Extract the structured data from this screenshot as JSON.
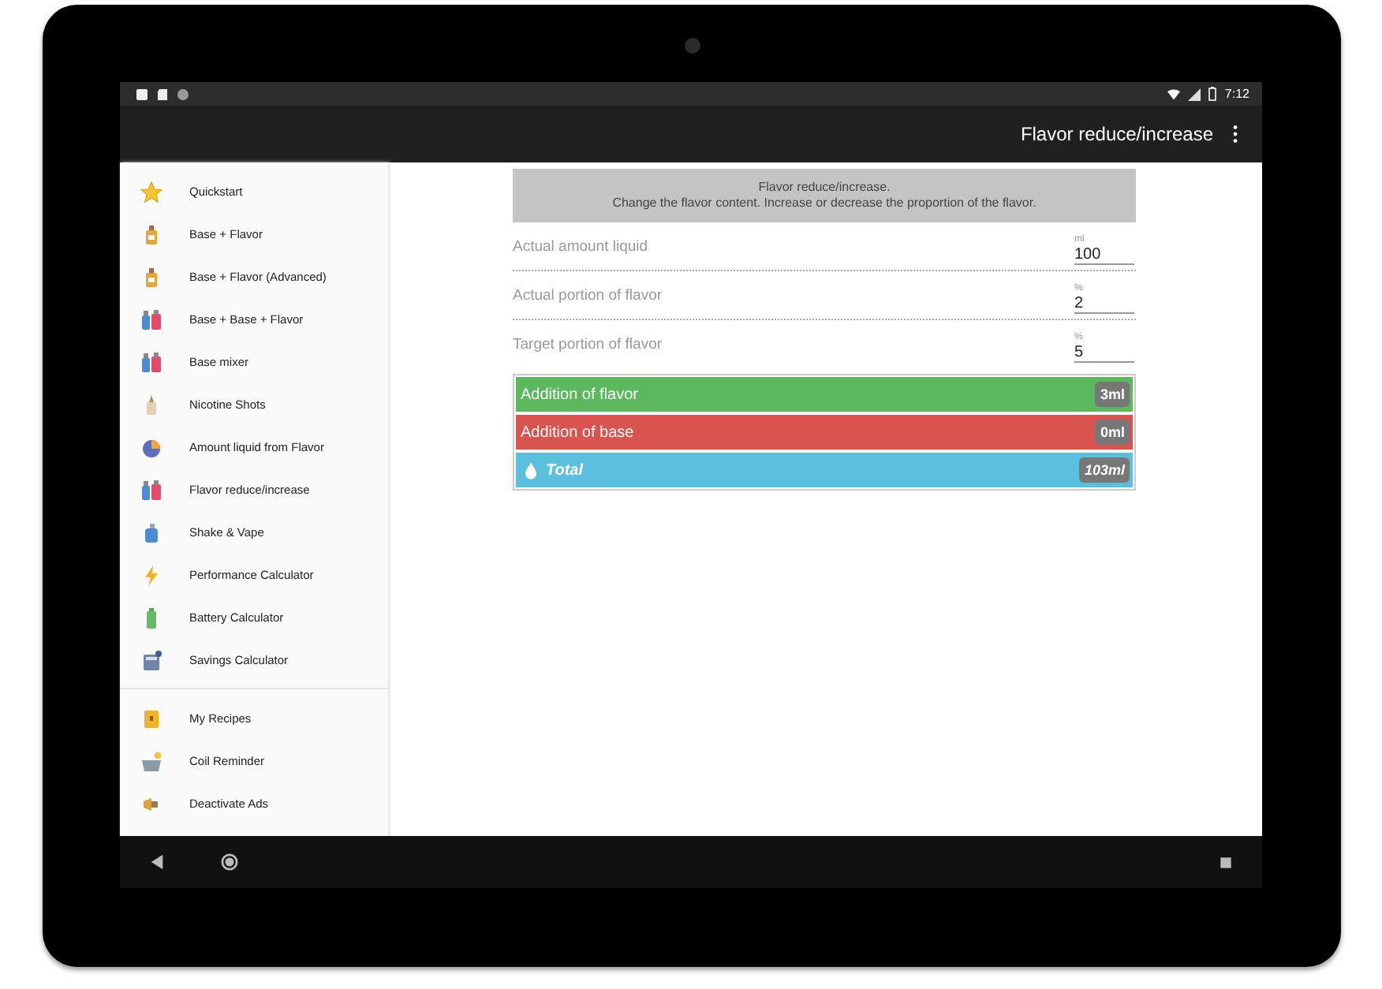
{
  "status_bar": {
    "time": "7:12"
  },
  "app_bar": {
    "title": "Flavor reduce/increase"
  },
  "sidebar": {
    "items": [
      {
        "label": "Quickstart"
      },
      {
        "label": "Base + Flavor"
      },
      {
        "label": "Base + Flavor (Advanced)"
      },
      {
        "label": "Base + Base + Flavor"
      },
      {
        "label": "Base mixer"
      },
      {
        "label": "Nicotine Shots"
      },
      {
        "label": "Amount liquid from Flavor"
      },
      {
        "label": "Flavor reduce/increase"
      },
      {
        "label": "Shake & Vape"
      },
      {
        "label": "Performance Calculator"
      },
      {
        "label": "Battery Calculator"
      },
      {
        "label": "Savings Calculator"
      }
    ],
    "extra_items": [
      {
        "label": "My Recipes"
      },
      {
        "label": "Coil Reminder"
      },
      {
        "label": "Deactivate Ads"
      }
    ]
  },
  "header": {
    "title": "Flavor reduce/increase.",
    "description": "Change the flavor content. Increase or decrease the proportion of the flavor."
  },
  "fields": [
    {
      "label": "Actual amount liquid",
      "unit": "ml",
      "value": "100"
    },
    {
      "label": "Actual portion of flavor",
      "unit": "%",
      "value": "2"
    },
    {
      "label": "Target portion of flavor",
      "unit": "%",
      "value": "5"
    }
  ],
  "results": [
    {
      "kind": "addition",
      "label": "Addition of flavor",
      "value": "3ml",
      "color": "#5cb85c"
    },
    {
      "kind": "addition",
      "label": "Addition of base",
      "value": "0ml",
      "color": "#d9534f"
    },
    {
      "kind": "total",
      "label": "Total",
      "value": "103ml",
      "color": "#5bc0de"
    }
  ]
}
